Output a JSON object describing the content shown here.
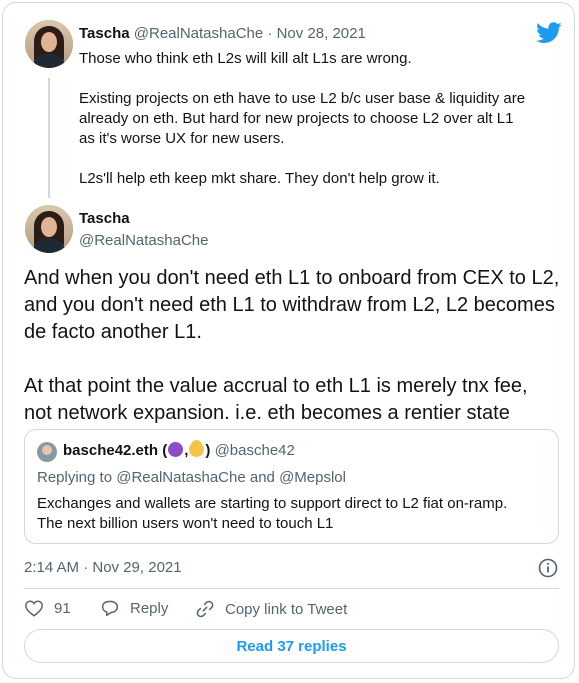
{
  "colors": {
    "accent": "#1d9bf0",
    "muted": "#536471",
    "border": "#cfd9de",
    "text": "#0f1419"
  },
  "tweet1": {
    "name": "Tascha",
    "handle": "@RealNatashaChe",
    "separator": "·",
    "date": "Nov 28, 2021",
    "lines": [
      "Those who think eth L2s will kill alt L1s are wrong.",
      "Existing projects on eth have to use L2 b/c user base & liquidity are",
      "already on eth. But hard for new projects to choose L2 over alt L1",
      "as it's worse UX for new users.",
      "L2s'll help eth keep mkt share. They don't help grow it."
    ]
  },
  "tweet2": {
    "name": "Tascha",
    "handle": "@RealNatashaChe",
    "lines": [
      "And when you don't need eth L1 to onboard from CEX to L2,",
      "and you don't need eth L1 to withdraw from L2, L2 becomes",
      "de facto another L1.",
      "At that point the value accrual to eth L1 is merely tnx fee,",
      "not network expansion. i.e. eth becomes a rentier state"
    ],
    "timestamp": "2:14 AM · Nov 29, 2021"
  },
  "quote": {
    "name": "basche42.eth (",
    "name_sep": ",",
    "name_close": ")",
    "handle": "@basche42",
    "replying_prefix": "Replying to",
    "replying_user1": "@RealNatashaChe",
    "replying_and": "and",
    "replying_user2": "@Mepslol",
    "lines": [
      "Exchanges and wallets are starting to support direct to L2 fiat on-ramp.",
      "The next billion users won't need to touch L1"
    ]
  },
  "actions": {
    "likes": "91",
    "reply": "Reply",
    "copy_link": "Copy link to Tweet"
  },
  "read_replies": "Read 37 replies",
  "icons": [
    "twitter-bird-icon",
    "heart-icon",
    "reply-icon",
    "link-icon",
    "info-icon"
  ]
}
